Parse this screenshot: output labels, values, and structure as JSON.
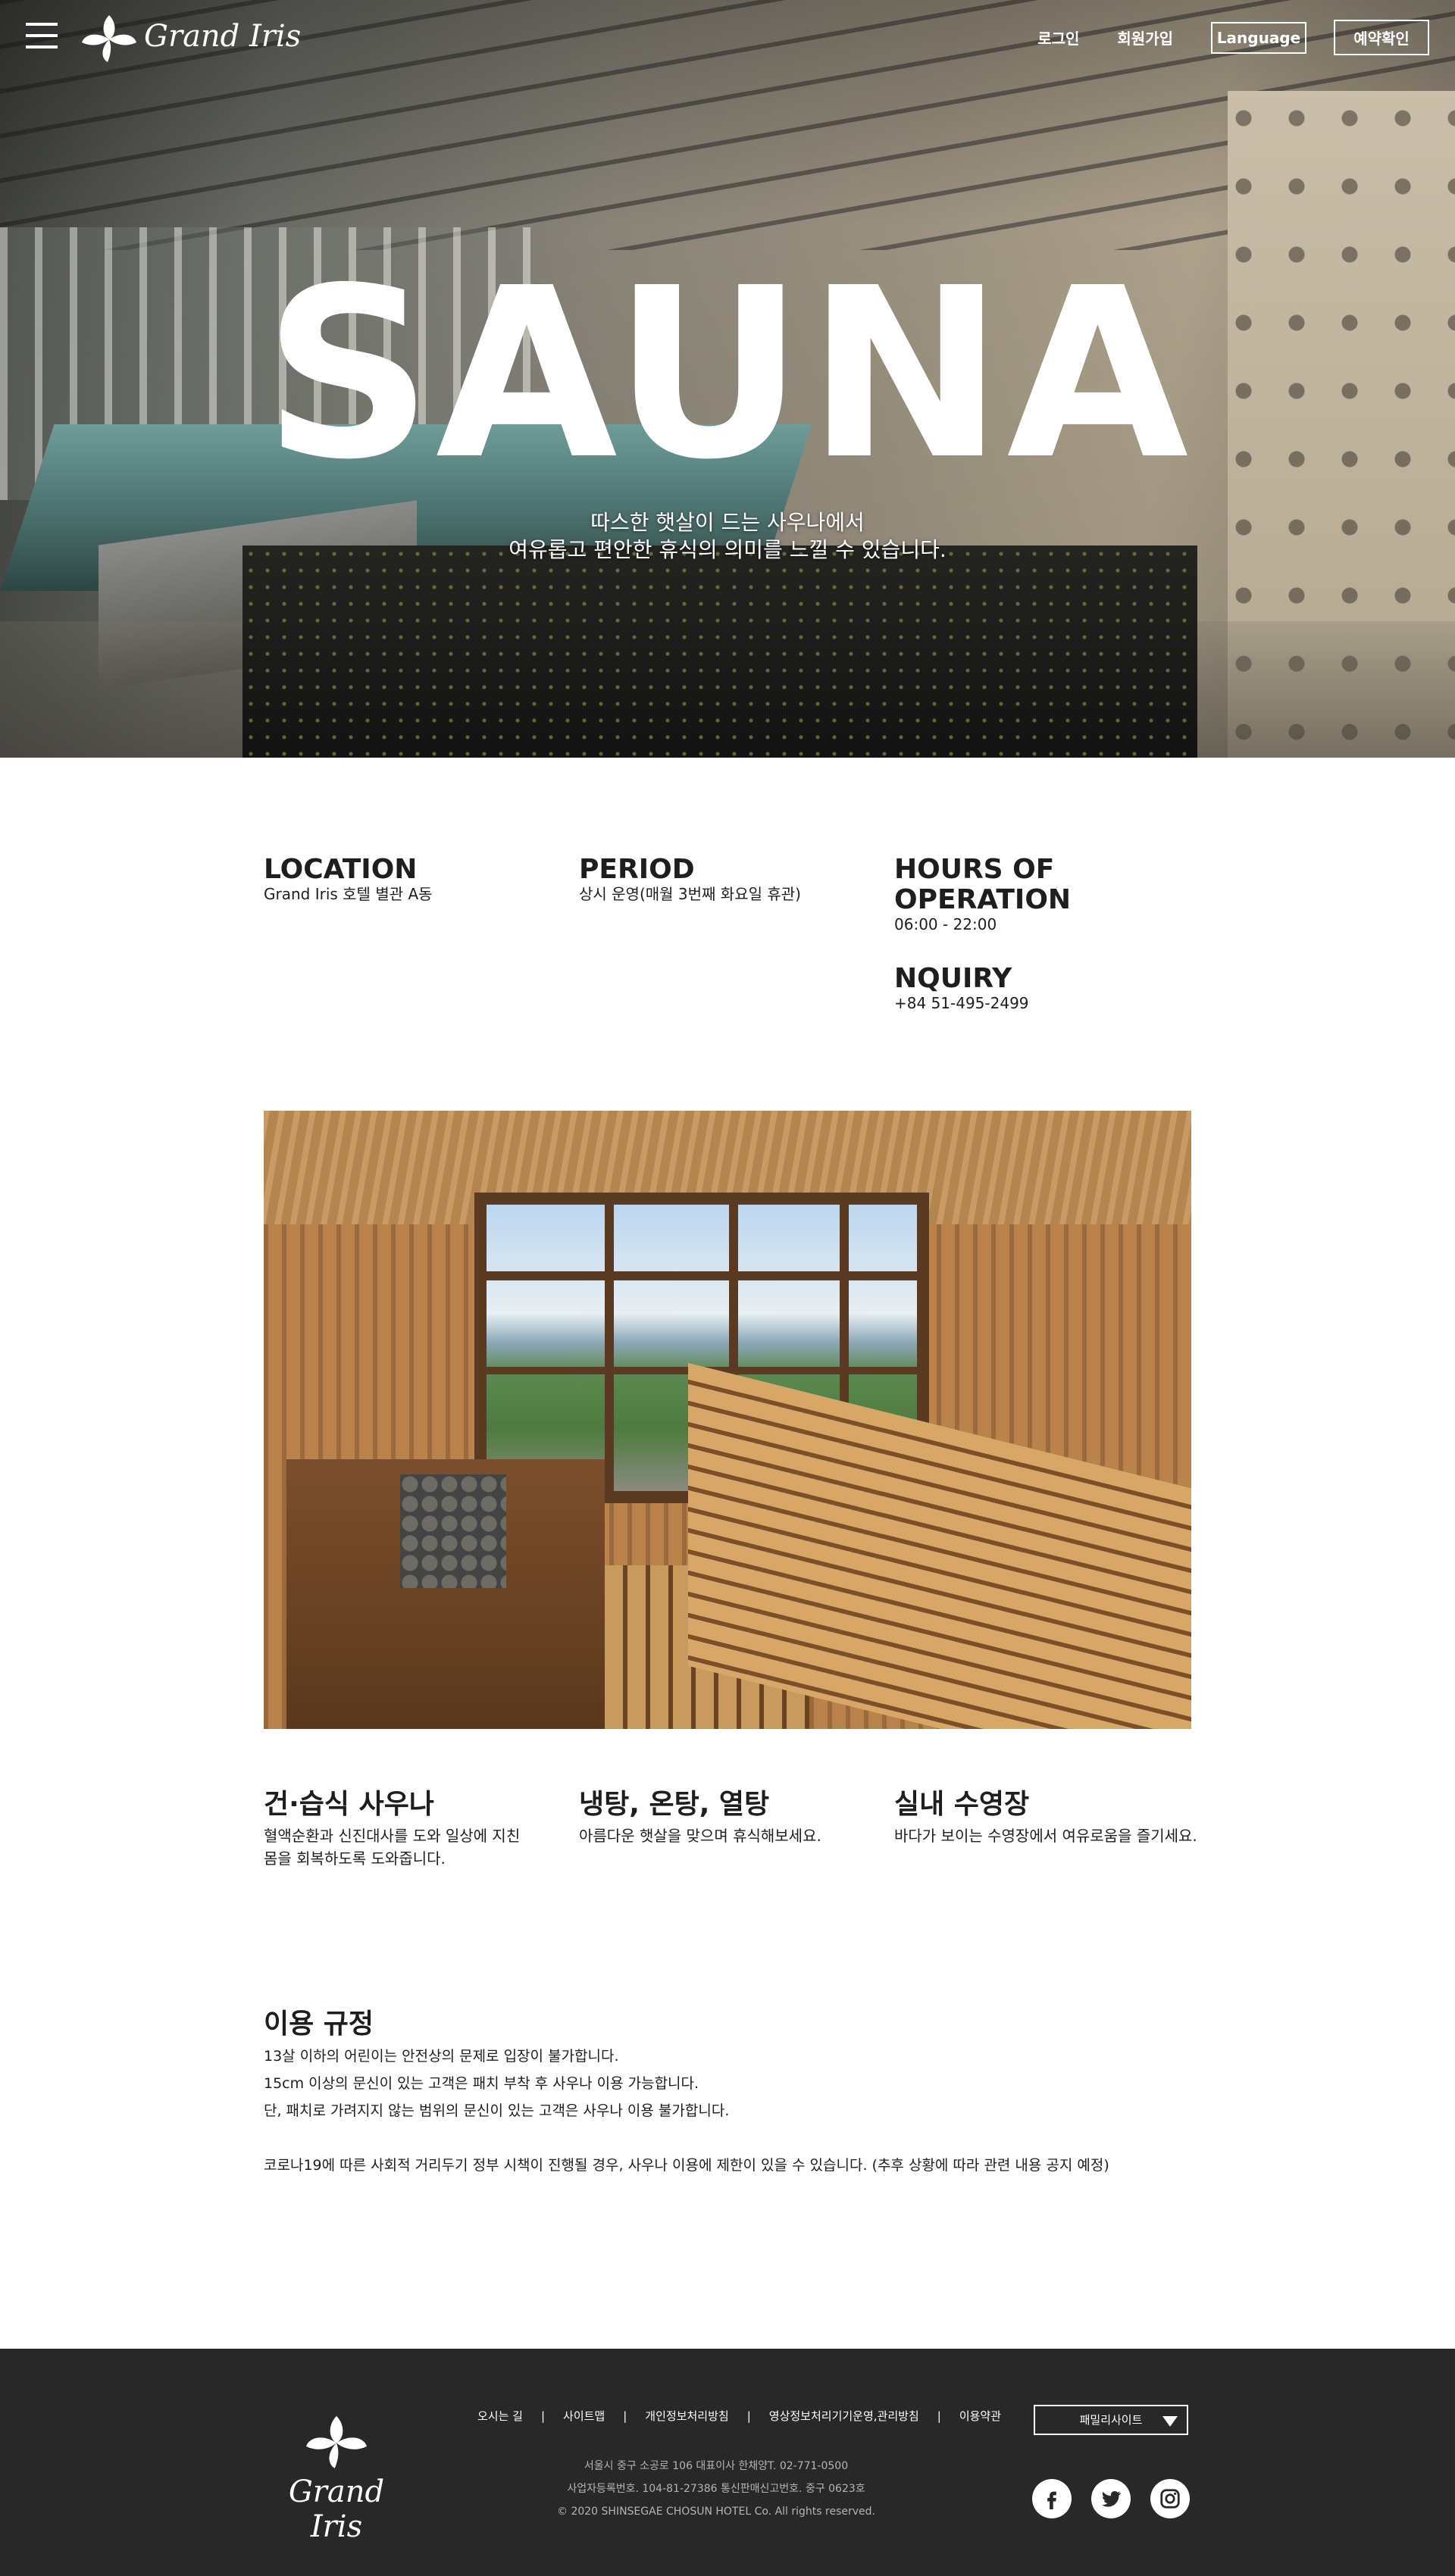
{
  "header": {
    "brand_name": "Grand Iris",
    "nav": {
      "login": "로그인",
      "signup": "회원가입",
      "language": "Language",
      "reservation": "예약확인"
    }
  },
  "hero": {
    "title": "SAUNA",
    "subtitle_line1": "따스한 햇살이 드는 사우나에서",
    "subtitle_line2": "여유롭고 편안한 휴식의 의미를 느낄 수 있습니다."
  },
  "info": {
    "location": {
      "label": "LOCATION",
      "value": "Grand Iris 호텔 별관 A동"
    },
    "period": {
      "label": "PERIOD",
      "value": "상시 운영(매월 3번째 화요일 휴관)"
    },
    "hours": {
      "label": "HOURS OF OPERATION",
      "value": "06:00 - 22:00"
    },
    "inquiry": {
      "label": "NQUIRY",
      "value": "+84 51-495-2499"
    }
  },
  "features": [
    {
      "title": "건·습식 사우나",
      "text_line1": "혈액순환과 신진대사를 도와 일상에 지친",
      "text_line2": "몸을 회복하도록 도와줍니다."
    },
    {
      "title": "냉탕, 온탕, 열탕",
      "text_line1": "아름다운 햇살을 맞으며 휴식해보세요.",
      "text_line2": ""
    },
    {
      "title": "실내 수영장",
      "text_line1": "바다가 보이는 수영장에서 여유로움을 즐기세요.",
      "text_line2": ""
    }
  ],
  "rules": {
    "title": "이용 규정",
    "lines": [
      "13살 이하의 어린이는 안전상의 문제로 입장이 불가합니다.",
      "15cm 이상의 문신이 있는 고객은 패치 부착 후 사우나 이용 가능합니다.",
      "단, 패치로 가려지지 않는 범위의 문신이 있는 고객은 사우나 이용 불가합니다."
    ],
    "notice": "코로나19에 따른 사회적 거리두기 정부 시책이 진행될 경우, 사우나 이용에 제한이 있을 수 있습니다. (추후 상황에 따라 관련 내용 공지 예정)"
  },
  "footer": {
    "brand_name": "Grand Iris",
    "links": [
      "오시는 길",
      "사이트맵",
      "개인정보처리방침",
      "영상정보처리기기운영,관리방침",
      "이용약관"
    ],
    "separator": "|",
    "address_lines": [
      "서울시 중구 소공로 106 대표이사 한채양T. 02-771-0500",
      "사업자등록번호. 104-81-27386 통신판매신고번호. 중구 0623호",
      "© 2020 SHINSEGAE CHOSUN HOTEL Co. All rights reserved."
    ],
    "family_site": "패밀리사이트",
    "social": [
      "facebook-icon",
      "twitter-icon",
      "instagram-icon"
    ]
  },
  "colors": {
    "footer_bg": "#282828",
    "text_dark": "#1e1e1e",
    "white": "#ffffff"
  }
}
